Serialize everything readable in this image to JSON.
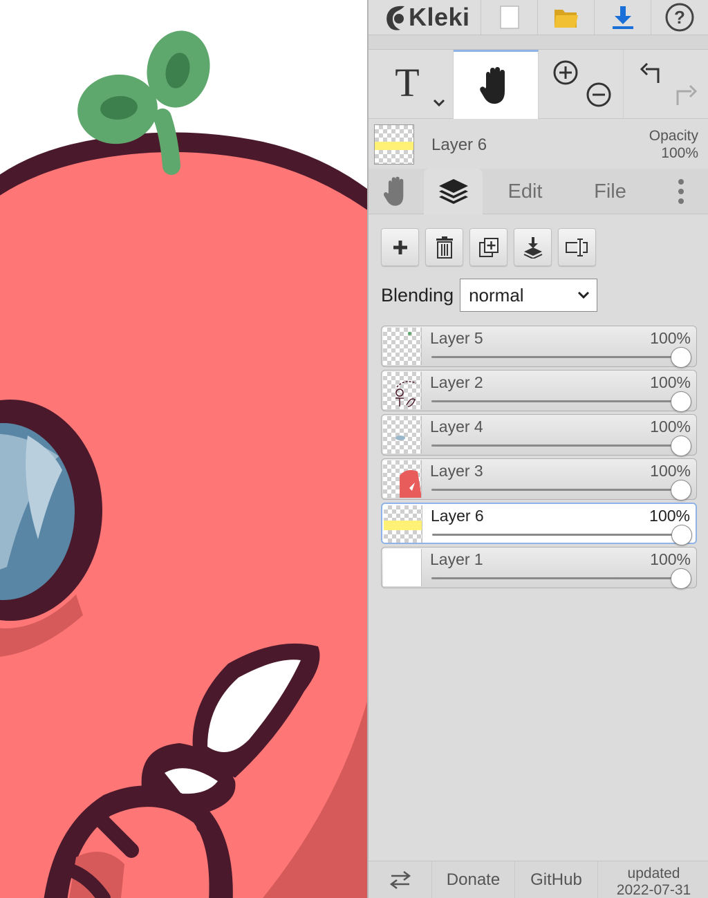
{
  "app": {
    "name": "Kleki"
  },
  "colors": {
    "accent": "#8fb3e6",
    "body": "#ff7676",
    "outline": "#4a1a2c",
    "leaf": "#5fa86d",
    "download": "#1a6fd8",
    "folder": "#f2c033"
  },
  "topbar": {
    "buttons": [
      {
        "icon": "new-file-icon"
      },
      {
        "icon": "open-folder-icon"
      },
      {
        "icon": "download-icon"
      },
      {
        "icon": "help-icon"
      }
    ]
  },
  "tools": {
    "text_tool": "T",
    "hand_tool_active": true,
    "icons": [
      "text-tool-icon",
      "hand-tool-icon",
      "zoom-in-icon",
      "zoom-out-icon",
      "undo-icon",
      "redo-icon"
    ]
  },
  "current_layer": {
    "name": "Layer 6",
    "opacity_label": "Opacity",
    "opacity_value": "100%"
  },
  "tabs": {
    "edit": "Edit",
    "file": "File"
  },
  "blending": {
    "label": "Blending",
    "value": "normal"
  },
  "layers": [
    {
      "name": "Layer 5",
      "opacity": "100%",
      "selected": false,
      "value": 1.0
    },
    {
      "name": "Layer 2",
      "opacity": "100%",
      "selected": false,
      "value": 1.0
    },
    {
      "name": "Layer 4",
      "opacity": "100%",
      "selected": false,
      "value": 1.0
    },
    {
      "name": "Layer 3",
      "opacity": "100%",
      "selected": false,
      "value": 1.0
    },
    {
      "name": "Layer 6",
      "opacity": "100%",
      "selected": true,
      "value": 1.0
    },
    {
      "name": "Layer 1",
      "opacity": "100%",
      "selected": false,
      "value": 1.0
    }
  ],
  "footer": {
    "donate": "Donate",
    "github": "GitHub",
    "updated_label": "updated",
    "updated_date": "2022-07-31"
  }
}
